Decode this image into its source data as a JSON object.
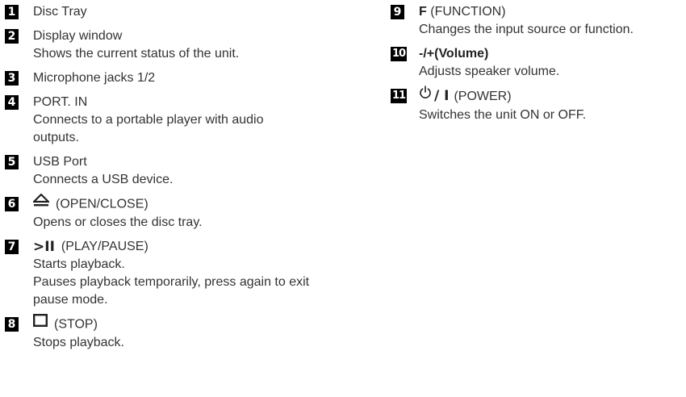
{
  "left_items": [
    {
      "num": "1",
      "title": "Disc Tray",
      "desc": []
    },
    {
      "num": "2",
      "title": "Display window",
      "desc": [
        "Shows the current status of the unit."
      ]
    },
    {
      "num": "3",
      "title": "Microphone jacks 1/2",
      "desc": []
    },
    {
      "num": "4",
      "title": "PORT. IN",
      "desc": [
        "Connects to a portable player with audio outputs."
      ]
    },
    {
      "num": "5",
      "title": "USB Port",
      "desc": [
        "Connects a USB device."
      ]
    },
    {
      "num": "6",
      "title": "(OPEN/CLOSE)",
      "icon": "eject-icon",
      "desc": [
        "Opens or closes the disc tray."
      ]
    },
    {
      "num": "7",
      "title": "(PLAY/PAUSE)",
      "symbol": ">II",
      "icon": "play-pause-icon",
      "desc": [
        "Starts playback.",
        "Pauses playback temporarily, press again to exit pause mode."
      ]
    },
    {
      "num": "8",
      "title": "(STOP)",
      "icon": "stop-icon",
      "desc": [
        "Stops playback."
      ]
    }
  ],
  "right_items": [
    {
      "num": "9",
      "key": "F",
      "title": "(FUNCTION)",
      "desc": [
        "Changes the input source or function."
      ]
    },
    {
      "num": "10",
      "key": "-/+(Volume)",
      "title": "",
      "desc": [
        "Adjusts speaker volume."
      ]
    },
    {
      "num": "11",
      "key": "/ I",
      "title": "(POWER)",
      "icon": "power-icon",
      "desc": [
        "Switches the unit ON or OFF."
      ]
    }
  ]
}
